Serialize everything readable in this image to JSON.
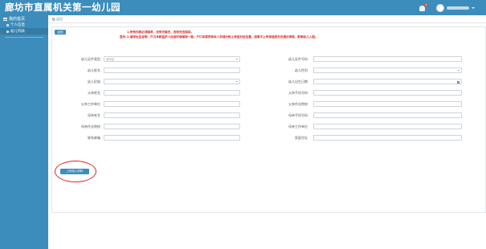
{
  "app": {
    "title": "廊坊市直属机关第一幼儿园"
  },
  "header": {
    "notification_count": "4"
  },
  "sidebar": {
    "title": "我的首页",
    "items": [
      {
        "label": "个人信息"
      },
      {
        "label": "幼儿列表"
      }
    ]
  },
  "breadcrumb": {
    "text": "返回"
  },
  "panel": {
    "back_label": "返回",
    "notice": {
      "label": "提示:",
      "lines": [
        "1.所有内容必须填写，没有可填无，否则无法保存。",
        "2.填写出生证明、户口本和监护人信息时请保持一致，户口本首页和本人页请分别上传至对应位置，如果不上传将造成无法通过审核，影响幼儿入园。"
      ]
    },
    "upload_label": "上传幼儿材料"
  },
  "form": {
    "left": [
      {
        "label": "幼儿证件类型",
        "value": "身份证",
        "type": "select"
      },
      {
        "label": "幼儿姓名",
        "value": "",
        "type": "text"
      },
      {
        "label": "幼儿民族",
        "value": "",
        "type": "select"
      },
      {
        "label": "父亲姓名",
        "value": "",
        "type": "text"
      },
      {
        "label": "父亲工作单位",
        "value": "",
        "type": "text"
      },
      {
        "label": "母亲姓名",
        "value": "",
        "type": "text"
      },
      {
        "label": "母亲作业院校",
        "value": "",
        "type": "text"
      },
      {
        "label": "联系邮箱",
        "value": "",
        "type": "text"
      }
    ],
    "right": [
      {
        "label": "幼儿证件号码",
        "value": "",
        "type": "text"
      },
      {
        "label": "幼儿性别",
        "value": "",
        "type": "select"
      },
      {
        "label": "幼儿出生日期",
        "value": "",
        "type": "date"
      },
      {
        "label": "父亲手机号码",
        "value": "",
        "type": "text"
      },
      {
        "label": "父亲作业院校",
        "value": "",
        "type": "text"
      },
      {
        "label": "母亲手机号码",
        "value": "",
        "type": "text"
      },
      {
        "label": "母亲工作单位",
        "value": "",
        "type": "text"
      },
      {
        "label": "家庭住址",
        "value": "",
        "type": "text"
      }
    ]
  },
  "colors": {
    "primary": "#3c8dbc",
    "sidebar_active": "#357ca5",
    "notice": "#dd2222",
    "highlight_circle": "#e02424"
  },
  "icons": {
    "bell": "bell-icon",
    "user": "avatar",
    "location": "location-pin-icon"
  }
}
